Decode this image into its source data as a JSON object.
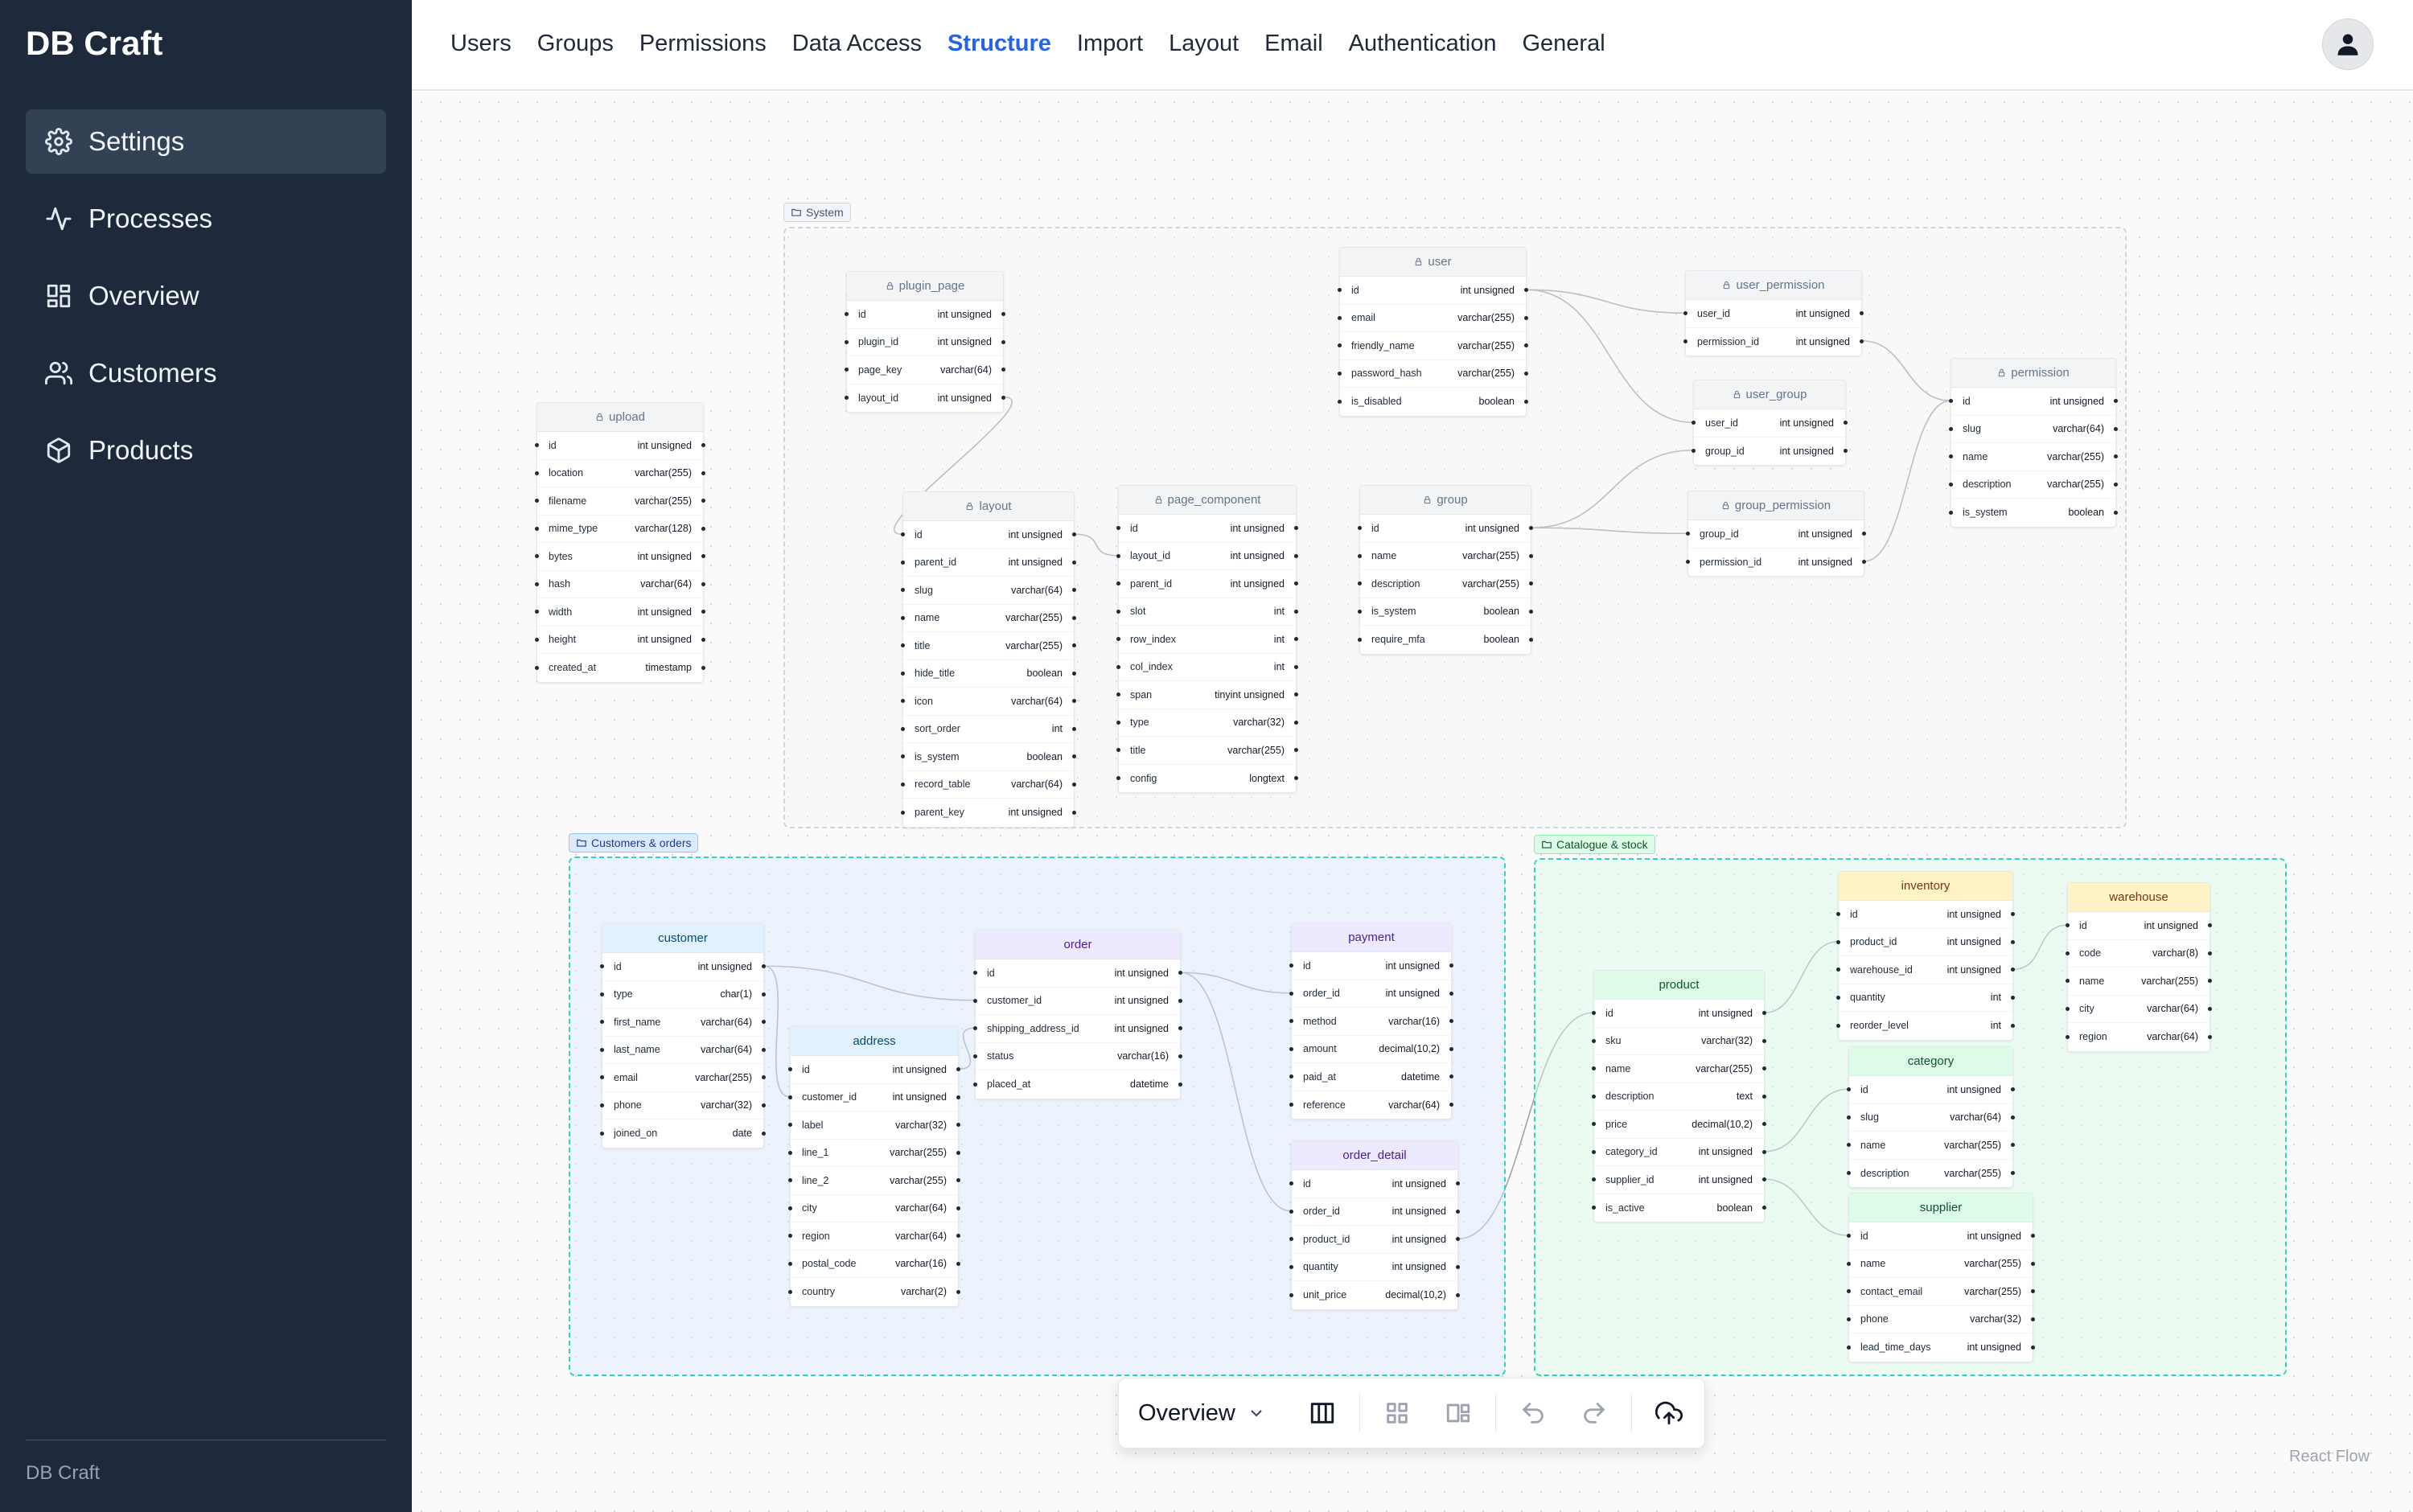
{
  "app": {
    "brand": "DB Craft",
    "footer": "DB Craft"
  },
  "sidebar": {
    "items": [
      {
        "label": "Settings",
        "icon": "gear-icon",
        "active": true
      },
      {
        "label": "Processes",
        "icon": "activity-icon"
      },
      {
        "label": "Overview",
        "icon": "dashboard-icon"
      },
      {
        "label": "Customers",
        "icon": "users-icon"
      },
      {
        "label": "Products",
        "icon": "box-icon"
      }
    ]
  },
  "tabs": [
    "Users",
    "Groups",
    "Permissions",
    "Data Access",
    "Structure",
    "Import",
    "Layout",
    "Email",
    "Authentication",
    "General"
  ],
  "active_tab": "Structure",
  "groups": {
    "system": "System",
    "customers": "Customers & orders",
    "catalogue": "Catalogue & stock"
  },
  "tables": {
    "upload": {
      "name": "upload",
      "rows": [
        [
          "id",
          "int unsigned"
        ],
        [
          "location",
          "varchar(255)"
        ],
        [
          "filename",
          "varchar(255)"
        ],
        [
          "mime_type",
          "varchar(128)"
        ],
        [
          "bytes",
          "int unsigned"
        ],
        [
          "hash",
          "varchar(64)"
        ],
        [
          "width",
          "int unsigned"
        ],
        [
          "height",
          "int unsigned"
        ],
        [
          "created_at",
          "timestamp"
        ]
      ]
    },
    "plugin_page": {
      "name": "plugin_page",
      "rows": [
        [
          "id",
          "int unsigned"
        ],
        [
          "plugin_id",
          "int unsigned"
        ],
        [
          "page_key",
          "varchar(64)"
        ],
        [
          "layout_id",
          "int unsigned"
        ]
      ]
    },
    "user": {
      "name": "user",
      "rows": [
        [
          "id",
          "int unsigned"
        ],
        [
          "email",
          "varchar(255)"
        ],
        [
          "friendly_name",
          "varchar(255)"
        ],
        [
          "password_hash",
          "varchar(255)"
        ],
        [
          "is_disabled",
          "boolean"
        ]
      ]
    },
    "user_permission": {
      "name": "user_permission",
      "rows": [
        [
          "user_id",
          "int unsigned"
        ],
        [
          "permission_id",
          "int unsigned"
        ]
      ]
    },
    "user_group": {
      "name": "user_group",
      "rows": [
        [
          "user_id",
          "int unsigned"
        ],
        [
          "group_id",
          "int unsigned"
        ]
      ]
    },
    "permission": {
      "name": "permission",
      "rows": [
        [
          "id",
          "int unsigned"
        ],
        [
          "slug",
          "varchar(64)"
        ],
        [
          "name",
          "varchar(255)"
        ],
        [
          "description",
          "varchar(255)"
        ],
        [
          "is_system",
          "boolean"
        ]
      ]
    },
    "layout": {
      "name": "layout",
      "rows": [
        [
          "id",
          "int unsigned"
        ],
        [
          "parent_id",
          "int unsigned"
        ],
        [
          "slug",
          "varchar(64)"
        ],
        [
          "name",
          "varchar(255)"
        ],
        [
          "title",
          "varchar(255)"
        ],
        [
          "hide_title",
          "boolean"
        ],
        [
          "icon",
          "varchar(64)"
        ],
        [
          "sort_order",
          "int"
        ],
        [
          "is_system",
          "boolean"
        ],
        [
          "record_table",
          "varchar(64)"
        ],
        [
          "parent_key",
          "int unsigned"
        ]
      ]
    },
    "page_component": {
      "name": "page_component",
      "rows": [
        [
          "id",
          "int unsigned"
        ],
        [
          "layout_id",
          "int unsigned"
        ],
        [
          "parent_id",
          "int unsigned"
        ],
        [
          "slot",
          "int"
        ],
        [
          "row_index",
          "int"
        ],
        [
          "col_index",
          "int"
        ],
        [
          "span",
          "tinyint unsigned"
        ],
        [
          "type",
          "varchar(32)"
        ],
        [
          "title",
          "varchar(255)"
        ],
        [
          "config",
          "longtext"
        ]
      ]
    },
    "group": {
      "name": "group",
      "rows": [
        [
          "id",
          "int unsigned"
        ],
        [
          "name",
          "varchar(255)"
        ],
        [
          "description",
          "varchar(255)"
        ],
        [
          "is_system",
          "boolean"
        ],
        [
          "require_mfa",
          "boolean"
        ]
      ]
    },
    "group_permission": {
      "name": "group_permission",
      "rows": [
        [
          "group_id",
          "int unsigned"
        ],
        [
          "permission_id",
          "int unsigned"
        ]
      ]
    },
    "customer": {
      "name": "customer",
      "rows": [
        [
          "id",
          "int unsigned"
        ],
        [
          "type",
          "char(1)"
        ],
        [
          "first_name",
          "varchar(64)"
        ],
        [
          "last_name",
          "varchar(64)"
        ],
        [
          "email",
          "varchar(255)"
        ],
        [
          "phone",
          "varchar(32)"
        ],
        [
          "joined_on",
          "date"
        ]
      ]
    },
    "address": {
      "name": "address",
      "rows": [
        [
          "id",
          "int unsigned"
        ],
        [
          "customer_id",
          "int unsigned"
        ],
        [
          "label",
          "varchar(32)"
        ],
        [
          "line_1",
          "varchar(255)"
        ],
        [
          "line_2",
          "varchar(255)"
        ],
        [
          "city",
          "varchar(64)"
        ],
        [
          "region",
          "varchar(64)"
        ],
        [
          "postal_code",
          "varchar(16)"
        ],
        [
          "country",
          "varchar(2)"
        ]
      ]
    },
    "order": {
      "name": "order",
      "rows": [
        [
          "id",
          "int unsigned"
        ],
        [
          "customer_id",
          "int unsigned"
        ],
        [
          "shipping_address_id",
          "int unsigned"
        ],
        [
          "status",
          "varchar(16)"
        ],
        [
          "placed_at",
          "datetime"
        ]
      ]
    },
    "payment": {
      "name": "payment",
      "rows": [
        [
          "id",
          "int unsigned"
        ],
        [
          "order_id",
          "int unsigned"
        ],
        [
          "method",
          "varchar(16)"
        ],
        [
          "amount",
          "decimal(10,2)"
        ],
        [
          "paid_at",
          "datetime"
        ],
        [
          "reference",
          "varchar(64)"
        ]
      ]
    },
    "order_detail": {
      "name": "order_detail",
      "rows": [
        [
          "id",
          "int unsigned"
        ],
        [
          "order_id",
          "int unsigned"
        ],
        [
          "product_id",
          "int unsigned"
        ],
        [
          "quantity",
          "int unsigned"
        ],
        [
          "unit_price",
          "decimal(10,2)"
        ]
      ]
    },
    "product": {
      "name": "product",
      "rows": [
        [
          "id",
          "int unsigned"
        ],
        [
          "sku",
          "varchar(32)"
        ],
        [
          "name",
          "varchar(255)"
        ],
        [
          "description",
          "text"
        ],
        [
          "price",
          "decimal(10,2)"
        ],
        [
          "category_id",
          "int unsigned"
        ],
        [
          "supplier_id",
          "int unsigned"
        ],
        [
          "is_active",
          "boolean"
        ]
      ]
    },
    "inventory": {
      "name": "inventory",
      "rows": [
        [
          "id",
          "int unsigned"
        ],
        [
          "product_id",
          "int unsigned"
        ],
        [
          "warehouse_id",
          "int unsigned"
        ],
        [
          "quantity",
          "int"
        ],
        [
          "reorder_level",
          "int"
        ]
      ]
    },
    "warehouse": {
      "name": "warehouse",
      "rows": [
        [
          "id",
          "int unsigned"
        ],
        [
          "code",
          "varchar(8)"
        ],
        [
          "name",
          "varchar(255)"
        ],
        [
          "city",
          "varchar(64)"
        ],
        [
          "region",
          "varchar(64)"
        ]
      ]
    },
    "category": {
      "name": "category",
      "rows": [
        [
          "id",
          "int unsigned"
        ],
        [
          "slug",
          "varchar(64)"
        ],
        [
          "name",
          "varchar(255)"
        ],
        [
          "description",
          "varchar(255)"
        ]
      ]
    },
    "supplier": {
      "name": "supplier",
      "rows": [
        [
          "id",
          "int unsigned"
        ],
        [
          "name",
          "varchar(255)"
        ],
        [
          "contact_email",
          "varchar(255)"
        ],
        [
          "phone",
          "varchar(32)"
        ],
        [
          "lead_time_days",
          "int unsigned"
        ]
      ]
    }
  },
  "toolbar": {
    "view": "Overview"
  },
  "attribution": "React Flow"
}
